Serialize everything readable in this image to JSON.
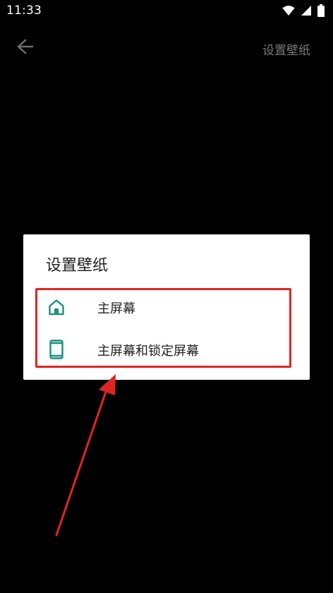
{
  "status_bar": {
    "time": "11:33",
    "icons": [
      "wifi-icon",
      "signal-icon",
      "battery-icon"
    ]
  },
  "app_bar": {
    "back_icon": "arrow-left-icon",
    "title": "设置壁纸"
  },
  "dialog": {
    "title": "设置壁纸",
    "options": [
      {
        "icon": "home-icon",
        "label": "主屏幕"
      },
      {
        "icon": "phone-icon",
        "label": "主屏幕和锁定屏幕"
      }
    ]
  },
  "colors": {
    "background": "#000000",
    "dialog_background": "#ffffff",
    "accent": "#1a8f80",
    "annotation_red": "#e02424",
    "app_bar_title": "#7a7a7a"
  }
}
